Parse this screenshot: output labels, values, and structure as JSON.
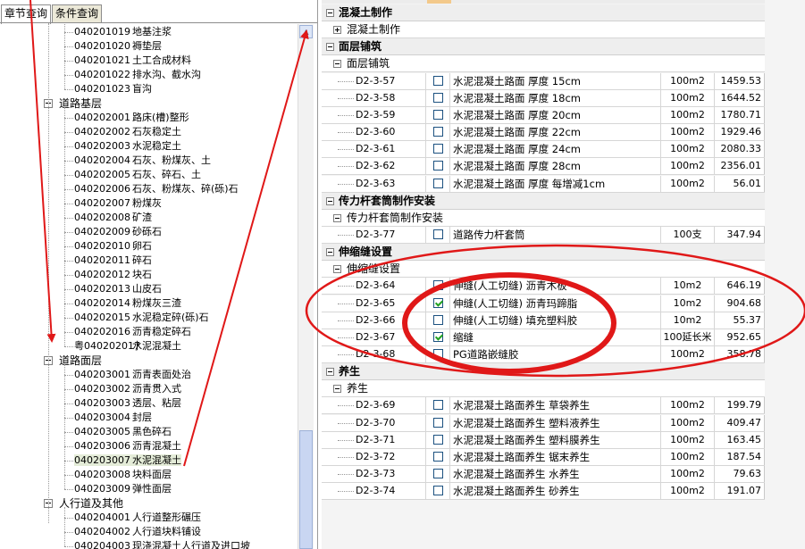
{
  "tabs": [
    {
      "label": "章节查询",
      "active": true
    },
    {
      "label": "条件查询",
      "active": false
    }
  ],
  "tree": {
    "items_top": [
      {
        "code": "040201019",
        "name": "地基注浆"
      },
      {
        "code": "040201020",
        "name": "褥垫层"
      },
      {
        "code": "040201021",
        "name": "土工合成材料"
      },
      {
        "code": "040201022",
        "name": "排水沟、截水沟"
      },
      {
        "code": "040201023",
        "name": "盲沟"
      }
    ],
    "group_base": "道路基层",
    "items_base": [
      {
        "code": "040202001",
        "name": "路床(槽)整形"
      },
      {
        "code": "040202002",
        "name": "石灰稳定土"
      },
      {
        "code": "040202003",
        "name": "水泥稳定土"
      },
      {
        "code": "040202004",
        "name": "石灰、粉煤灰、土"
      },
      {
        "code": "040202005",
        "name": "石灰、碎石、土"
      },
      {
        "code": "040202006",
        "name": "石灰、粉煤灰、碎(砾)石"
      },
      {
        "code": "040202007",
        "name": "粉煤灰"
      },
      {
        "code": "040202008",
        "name": "矿渣"
      },
      {
        "code": "040202009",
        "name": "砂砾石"
      },
      {
        "code": "040202010",
        "name": "卵石"
      },
      {
        "code": "040202011",
        "name": "碎石"
      },
      {
        "code": "040202012",
        "name": "块石"
      },
      {
        "code": "040202013",
        "name": "山皮石"
      },
      {
        "code": "040202014",
        "name": "粉煤灰三渣"
      },
      {
        "code": "040202015",
        "name": "水泥稳定碎(砾)石"
      },
      {
        "code": "040202016",
        "name": "沥青稳定碎石"
      },
      {
        "code": "粤040202017",
        "name": "水泥混凝土"
      }
    ],
    "group_surface": "道路面层",
    "items_surface": [
      {
        "code": "040203001",
        "name": "沥青表面处治"
      },
      {
        "code": "040203002",
        "name": "沥青贯入式"
      },
      {
        "code": "040203003",
        "name": "透层、粘层"
      },
      {
        "code": "040203004",
        "name": "封层"
      },
      {
        "code": "040203005",
        "name": "黑色碎石"
      },
      {
        "code": "040203006",
        "name": "沥青混凝土"
      },
      {
        "code": "040203007",
        "name": "水泥混凝土"
      },
      {
        "code": "040203008",
        "name": "块料面层"
      },
      {
        "code": "040203009",
        "name": "弹性面层"
      }
    ],
    "group_walk": "人行道及其他",
    "items_walk": [
      {
        "code": "040204001",
        "name": "人行道整形碾压"
      },
      {
        "code": "040204002",
        "name": "人行道块料铺设"
      },
      {
        "code": "040204003",
        "name": "现浇混凝土人行道及进口坡"
      }
    ]
  },
  "grid": {
    "sections": [
      {
        "cat": "混凝土制作",
        "sub": "混凝土制作",
        "sub_expand": "plus",
        "items": []
      },
      {
        "cat": "面层铺筑",
        "sub": "面层铺筑",
        "sub_expand": "minus",
        "items": [
          {
            "code": "D2-3-57",
            "checked": false,
            "name": "水泥混凝土路面 厚度 15cm",
            "unit": "100m2",
            "price": "1459.53"
          },
          {
            "code": "D2-3-58",
            "checked": false,
            "name": "水泥混凝土路面 厚度 18cm",
            "unit": "100m2",
            "price": "1644.52"
          },
          {
            "code": "D2-3-59",
            "checked": false,
            "name": "水泥混凝土路面 厚度 20cm",
            "unit": "100m2",
            "price": "1780.71"
          },
          {
            "code": "D2-3-60",
            "checked": false,
            "name": "水泥混凝土路面 厚度 22cm",
            "unit": "100m2",
            "price": "1929.46"
          },
          {
            "code": "D2-3-61",
            "checked": false,
            "name": "水泥混凝土路面 厚度 24cm",
            "unit": "100m2",
            "price": "2080.33"
          },
          {
            "code": "D2-3-62",
            "checked": false,
            "name": "水泥混凝土路面 厚度 28cm",
            "unit": "100m2",
            "price": "2356.01"
          },
          {
            "code": "D2-3-63",
            "checked": false,
            "name": "水泥混凝土路面 厚度 每增减1cm",
            "unit": "100m2",
            "price": "56.01"
          }
        ]
      },
      {
        "cat": "传力杆套筒制作安装",
        "sub": "传力杆套筒制作安装",
        "sub_expand": "minus",
        "items": [
          {
            "code": "D2-3-77",
            "checked": false,
            "name": "道路传力杆套筒",
            "unit": "100支",
            "price": "347.94"
          }
        ]
      },
      {
        "cat": "伸缩缝设置",
        "sub": "伸缩缝设置",
        "sub_expand": "minus",
        "items": [
          {
            "code": "D2-3-64",
            "checked": false,
            "name": "伸缝(人工切缝) 沥青木板",
            "unit": "10m2",
            "price": "646.19"
          },
          {
            "code": "D2-3-65",
            "checked": true,
            "name": "伸缝(人工切缝) 沥青玛蹄脂",
            "unit": "10m2",
            "price": "904.68"
          },
          {
            "code": "D2-3-66",
            "checked": false,
            "name": "伸缝(人工切缝) 填充塑料胶",
            "unit": "10m2",
            "price": "55.37"
          },
          {
            "code": "D2-3-67",
            "checked": true,
            "name": "缩缝",
            "unit": "100延长米",
            "price": "952.65"
          },
          {
            "code": "D2-3-68",
            "checked": false,
            "name": "PG道路嵌缝胶",
            "unit": "100m2",
            "price": "358.78"
          }
        ]
      },
      {
        "cat": "养生",
        "sub": "养生",
        "sub_expand": "minus",
        "items": [
          {
            "code": "D2-3-69",
            "checked": false,
            "name": "水泥混凝土路面养生 草袋养生",
            "unit": "100m2",
            "price": "199.79"
          },
          {
            "code": "D2-3-70",
            "checked": false,
            "name": "水泥混凝土路面养生 塑料液养生",
            "unit": "100m2",
            "price": "409.47"
          },
          {
            "code": "D2-3-71",
            "checked": false,
            "name": "水泥混凝土路面养生 塑料膜养生",
            "unit": "100m2",
            "price": "163.45"
          },
          {
            "code": "D2-3-72",
            "checked": false,
            "name": "水泥混凝土路面养生 锯末养生",
            "unit": "100m2",
            "price": "187.54"
          },
          {
            "code": "D2-3-73",
            "checked": false,
            "name": "水泥混凝土路面养生 水养生",
            "unit": "100m2",
            "price": "79.63"
          },
          {
            "code": "D2-3-74",
            "checked": false,
            "name": "水泥混凝土路面养生 砂养生",
            "unit": "100m2",
            "price": "191.07"
          }
        ]
      }
    ]
  },
  "annotation": {
    "color": "#e01818"
  },
  "icons": {
    "scroll_up": "scroll-up-icon",
    "scroll_down": "scroll-down-icon",
    "checkbox": "checkbox-icon"
  }
}
